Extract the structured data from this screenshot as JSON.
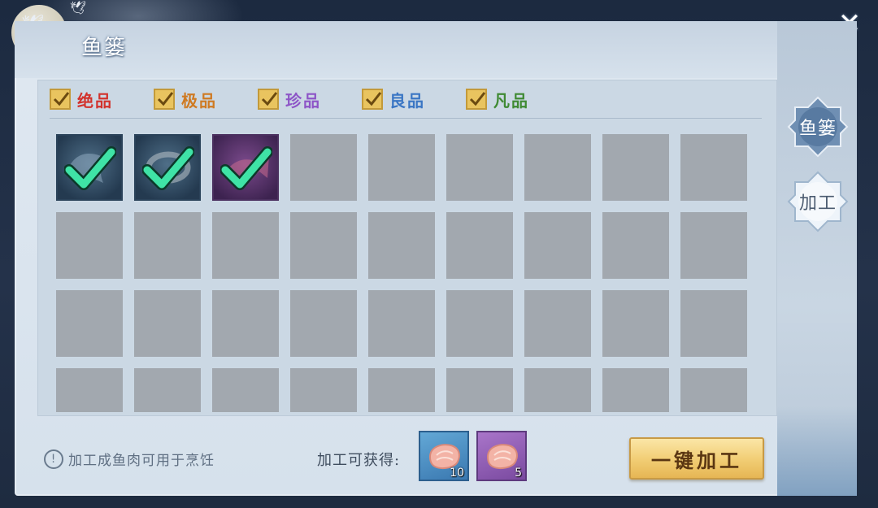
{
  "window": {
    "title": "鱼篓",
    "close_glyph": "✕"
  },
  "filters": [
    {
      "label": "绝品",
      "checked": true,
      "color": "#d2322c"
    },
    {
      "label": "极品",
      "checked": true,
      "color": "#cf7a22"
    },
    {
      "label": "珍品",
      "checked": true,
      "color": "#8d55c7"
    },
    {
      "label": "良品",
      "checked": true,
      "color": "#3a76c4"
    },
    {
      "label": "凡品",
      "checked": true,
      "color": "#3f8a33"
    }
  ],
  "grid": {
    "items": [
      {
        "name": "manta-ray",
        "rarity": "blue",
        "selected": true
      },
      {
        "name": "eel",
        "rarity": "blue",
        "selected": true
      },
      {
        "name": "betta-fish",
        "rarity": "purple",
        "selected": true
      }
    ]
  },
  "footer": {
    "hint_icon": "!",
    "hint": "加工成鱼肉可用于烹饪",
    "gain_label": "加工可获得:",
    "rewards": [
      {
        "name": "fish-meat",
        "rarity": "blue",
        "count": "10"
      },
      {
        "name": "fish-meat",
        "rarity": "purple",
        "count": "5"
      }
    ],
    "process_button": "一键加工"
  },
  "side_tabs": [
    {
      "label": "鱼篓",
      "active": false
    },
    {
      "label": "加工",
      "active": true
    }
  ],
  "colors": {
    "accent_gold": "#f1cc73",
    "panel": "#d6e1ec",
    "slot_empty": "#a2a8af"
  }
}
